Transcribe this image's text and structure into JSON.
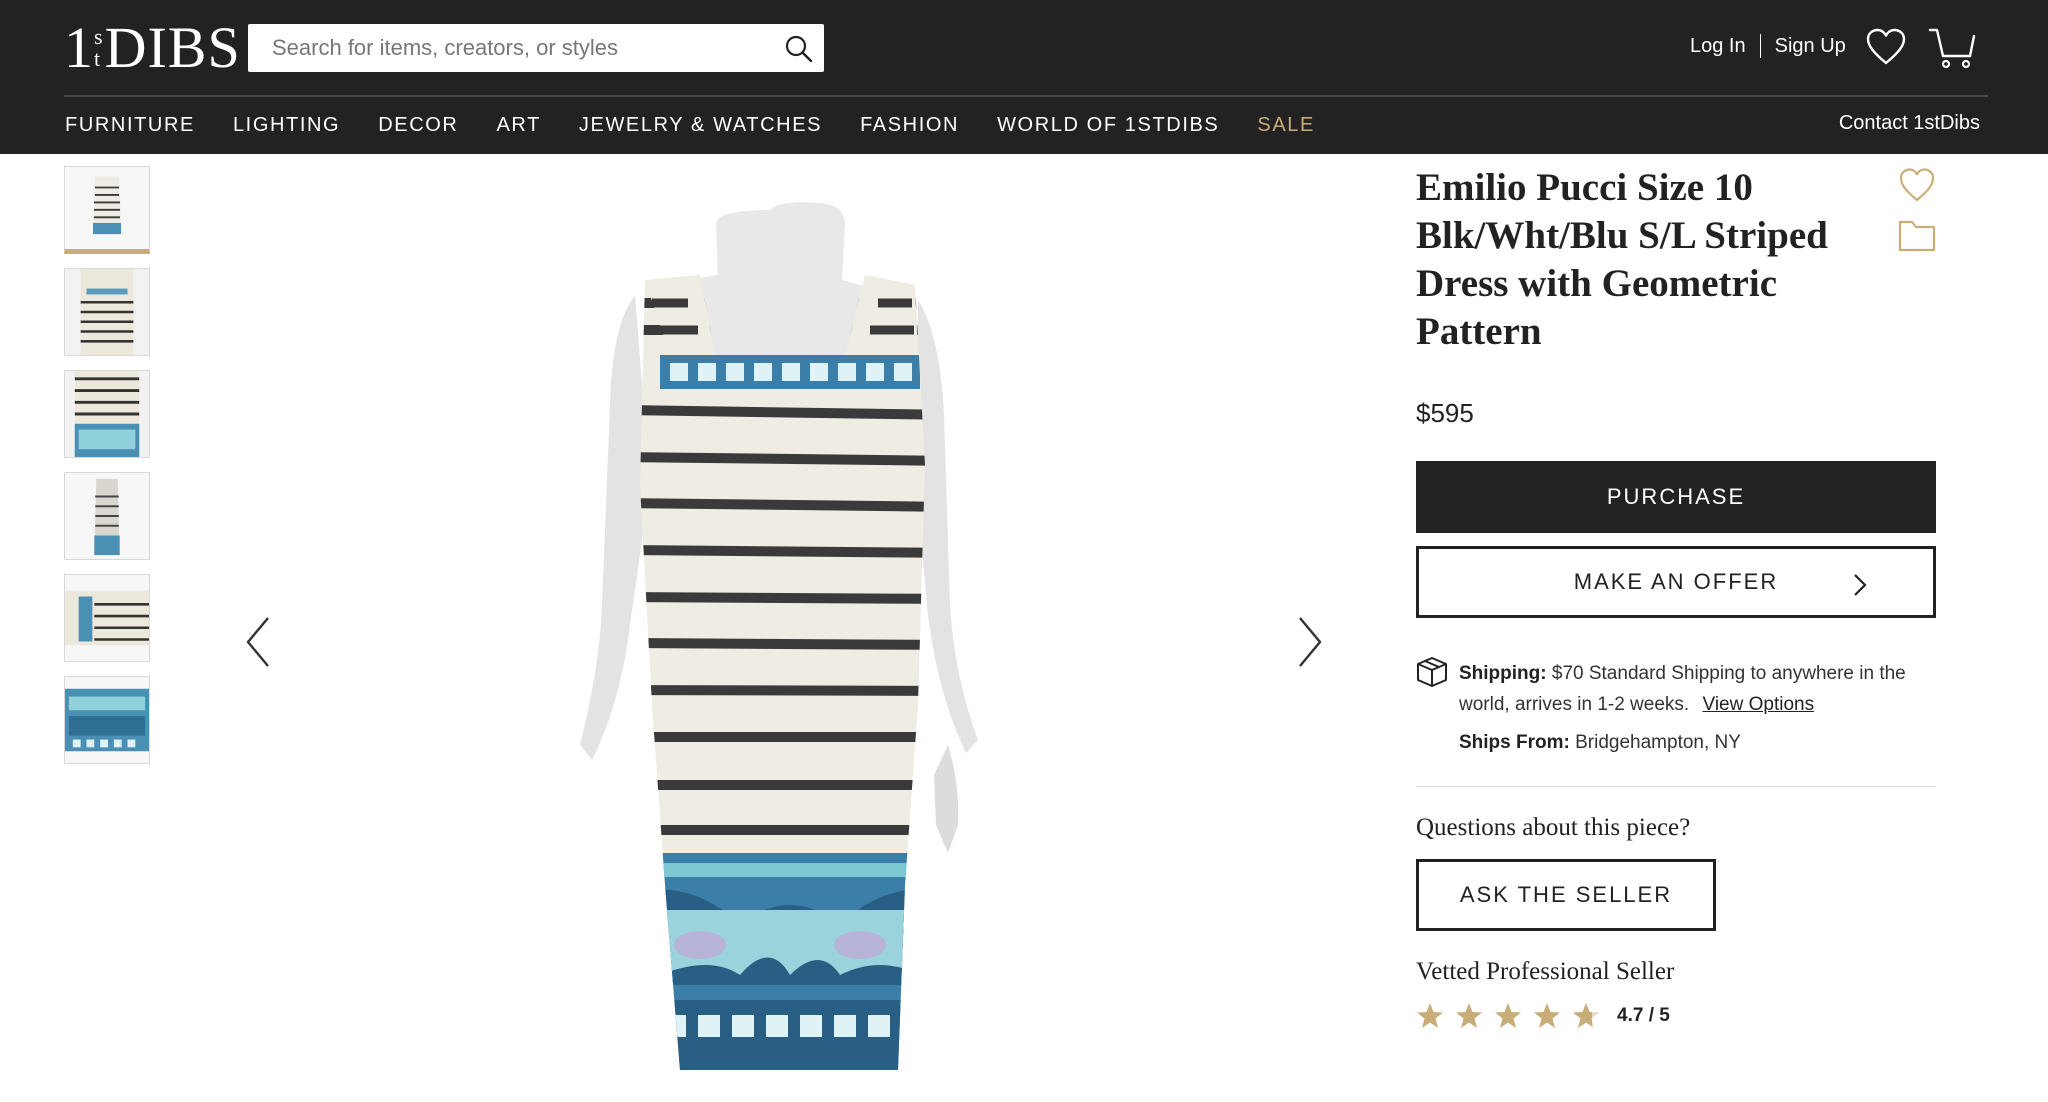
{
  "header": {
    "logo": {
      "one": "1",
      "s": "s",
      "t": "t",
      "dibs": "DIBS"
    },
    "search_placeholder": "Search for items, creators, or styles",
    "login": "Log In",
    "signup": "Sign Up",
    "contact": "Contact 1stDibs"
  },
  "nav": [
    "FURNITURE",
    "LIGHTING",
    "DECOR",
    "ART",
    "JEWELRY & WATCHES",
    "FASHION",
    "WORLD OF 1STDIBS",
    "SALE"
  ],
  "product": {
    "title": "Emilio Pucci Size 10 Blk/Wht/Blu S/L Striped Dress with Geometric Pattern",
    "price": "$595",
    "purchase_label": "PURCHASE",
    "offer_label": "MAKE AN OFFER",
    "shipping_label": "Shipping:",
    "shipping_text": "$70 Standard Shipping to anywhere in the world, arrives in 1-2 weeks.",
    "view_options": "View Options",
    "ships_from_label": "Ships From:",
    "ships_from_value": "Bridgehampton, NY",
    "questions": "Questions about this piece?",
    "ask_label": "ASK THE SELLER",
    "vetted": "Vetted Professional Seller",
    "rating": "4.7 / 5",
    "rating_value": 4.7
  },
  "colors": {
    "header_bg": "#222222",
    "accent_gold": "#c9ad78",
    "stripe": "#3a3a3a",
    "pattern_blue": "#3b7fa8",
    "pattern_teal": "#7cc7d2"
  },
  "icons": [
    "search-icon",
    "heart-icon",
    "cart-icon",
    "chevron-left-icon",
    "chevron-right-icon",
    "favorite-heart-icon",
    "folder-icon",
    "box-icon",
    "star-icon"
  ]
}
